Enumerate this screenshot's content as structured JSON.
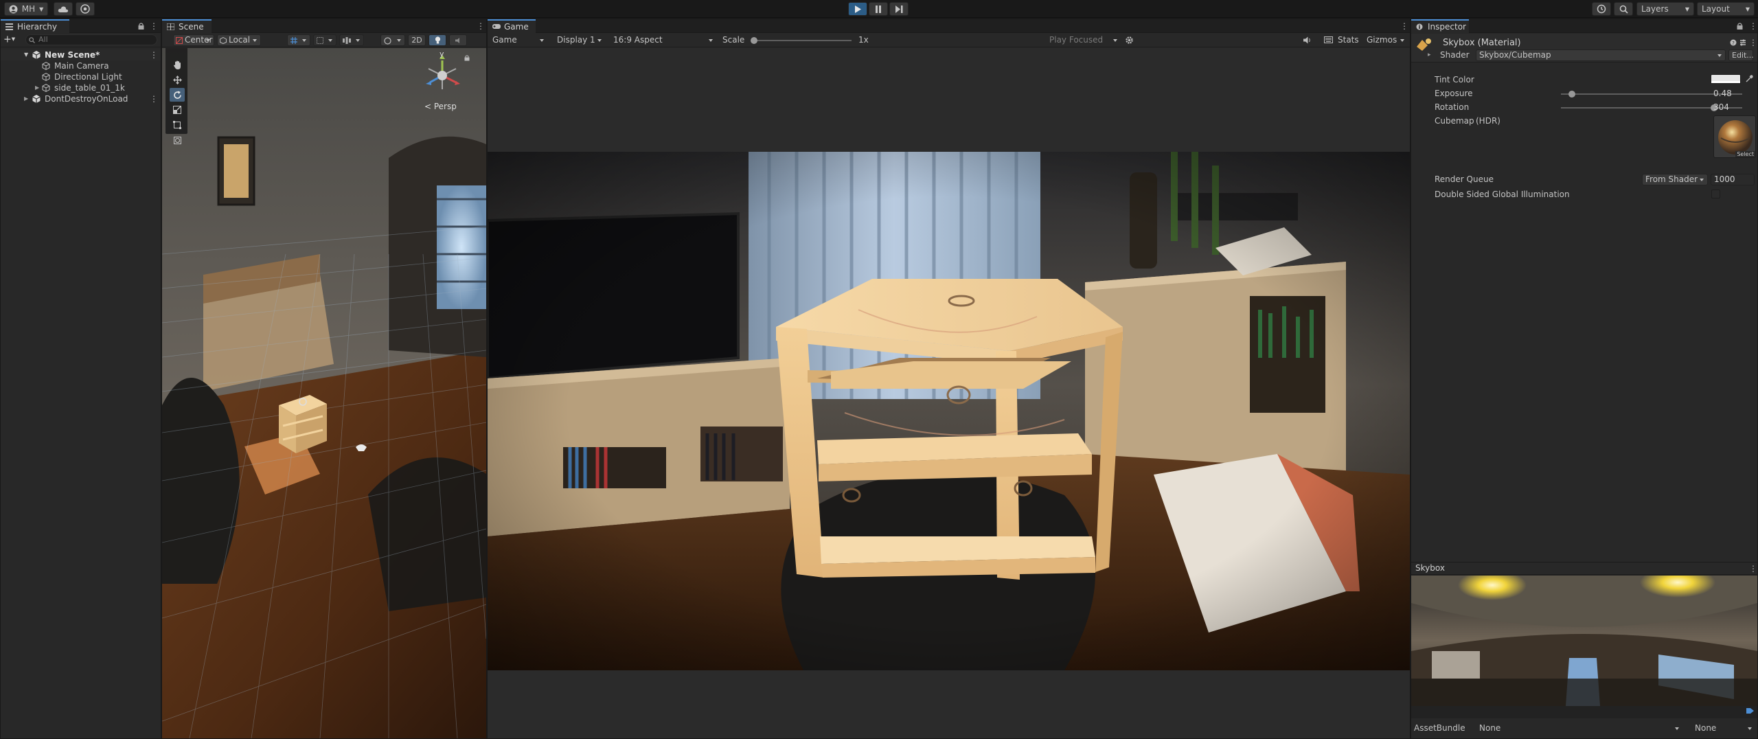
{
  "toolbar": {
    "account_label": "MH",
    "layers_label": "Layers",
    "layout_label": "Layout",
    "play_icon": "play-icon",
    "pause_icon": "pause-icon",
    "step_icon": "step-icon"
  },
  "hierarchy": {
    "tab_label": "Hierarchy",
    "search_placeholder": "All",
    "items": [
      {
        "label": "New Scene*",
        "bold": true
      },
      {
        "label": "Main Camera"
      },
      {
        "label": "Directional Light"
      },
      {
        "label": "side_table_01_1k"
      },
      {
        "label": "DontDestroyOnLoad"
      }
    ]
  },
  "scene": {
    "tab_label": "Scene",
    "pivot_label": "Center",
    "space_label": "Local",
    "mode_2d_label": "2D",
    "gizmo_axis_label": "y",
    "persp_label": "< Persp"
  },
  "game": {
    "tab_label": "Game",
    "view_label": "Game",
    "display_label": "Display 1",
    "aspect_label": "16:9 Aspect",
    "scale_label": "Scale",
    "scale_value": "1x",
    "play_focused_label": "Play Focused",
    "stats_label": "Stats",
    "gizmos_label": "Gizmos"
  },
  "inspector": {
    "tab_label": "Inspector",
    "title": "Skybox (Material)",
    "shader_label": "Shader",
    "shader_value": "Skybox/Cubemap",
    "edit_label": "Edit...",
    "tint_label": "Tint Color",
    "tint_color": "#e6e6e6",
    "exposure_label": "Exposure",
    "exposure_value": "0.48",
    "exposure_fraction": 0.06,
    "rotation_label": "Rotation",
    "rotation_value": "304",
    "rotation_fraction": 0.844,
    "cubemap_label": "Cubemap",
    "cubemap_hdr": "(HDR)",
    "select_label": "Select",
    "render_queue_label": "Render Queue",
    "render_queue_mode": "From Shader",
    "render_queue_value": "1000",
    "double_sided_label": "Double Sided Global Illumination",
    "preview_title": "Skybox",
    "assetbundle_label": "AssetBundle",
    "assetbundle_value": "None",
    "assetbundle_variant": "None"
  },
  "colors": {
    "accent": "#4d8fd6",
    "play_active": "#2c5d87",
    "panel": "#282828",
    "background": "#191919"
  }
}
